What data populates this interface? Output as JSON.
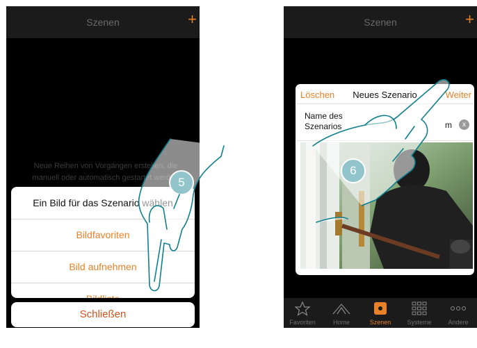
{
  "left_screen": {
    "title": "Szenen",
    "add_icon": "plus-icon",
    "hint_text": "Neue Reihen von Vorgängen erstellen, die manuell oder automatisch gestartet werden",
    "sheet": {
      "heading": "Ein Bild für das Szenario wählen",
      "options": [
        "Bildfavoriten",
        "Bild aufnehmen",
        "Bildliste"
      ],
      "close_label": "Schließen"
    },
    "step_badge": "5"
  },
  "right_screen": {
    "title": "Szenen",
    "add_icon": "plus-icon",
    "dialog": {
      "delete_label": "Löschen",
      "title": "Neues Szenario",
      "next_label": "Weiter",
      "name_label": "Name des Szenarios",
      "name_value": "m",
      "clear_icon": "clear-x-icon",
      "clear_glyph": "x"
    },
    "step_badge": "6",
    "tabs": [
      {
        "label": "Favoriten",
        "icon": "star-icon",
        "active": false
      },
      {
        "label": "Home",
        "icon": "house-icon",
        "active": false
      },
      {
        "label": "Szenen",
        "icon": "scenes-icon",
        "active": true
      },
      {
        "label": "Systeme",
        "icon": "grid-icon",
        "active": false
      },
      {
        "label": "Andere",
        "icon": "more-dots-icon",
        "active": false
      }
    ]
  },
  "colors": {
    "accent": "#e8822a",
    "badge": "#0e7f8c",
    "hand_outline": "#0e7f8c"
  }
}
